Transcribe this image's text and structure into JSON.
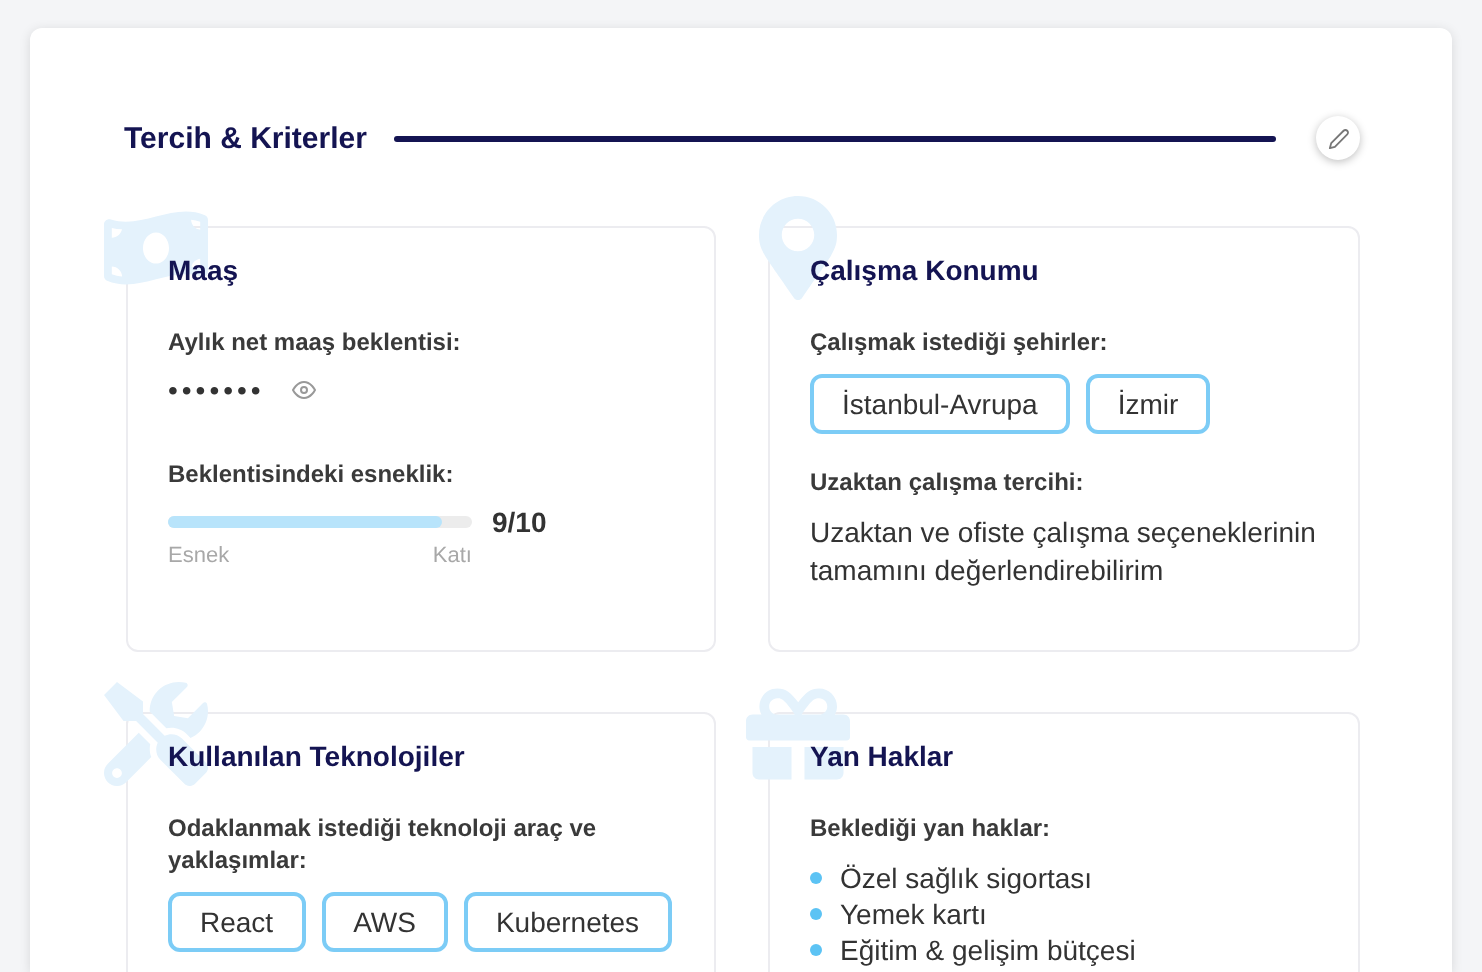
{
  "section": {
    "title": "Tercih & Kriterler"
  },
  "cards": [
    {
      "kind": "salary",
      "title": "Maaş",
      "blocks": [
        {
          "kind": "secret",
          "label": "Aylık net maaş beklentisi:",
          "value": "•••••••"
        },
        {
          "kind": "meter",
          "label": "Beklentisindeki esneklik:",
          "level": 0.9,
          "reading": "9/10",
          "min_label": "Esnek",
          "max_label": "Katı"
        }
      ]
    },
    {
      "kind": "location",
      "title": "Çalışma Konumu",
      "blocks": [
        {
          "kind": "tags",
          "label": "Çalışmak istediği şehirler:",
          "tags": [
            "İstanbul-Avrupa",
            "İzmir"
          ]
        },
        {
          "kind": "text",
          "label": "Uzaktan çalışma tercihi:",
          "text": "Uzaktan ve ofiste çalışma seçeneklerinin tamamını değerlendirebilirim"
        }
      ]
    },
    {
      "kind": "tech",
      "title": "Kullanılan Teknolojiler",
      "blocks": [
        {
          "kind": "tags",
          "label": "Odaklanmak istediği teknoloji araç ve yaklaşımlar:",
          "tags": [
            "React",
            "AWS",
            "Kubernetes"
          ]
        }
      ]
    },
    {
      "kind": "benefits",
      "title": "Yan Haklar",
      "blocks": [
        {
          "kind": "bullets",
          "label": "Beklediği yan haklar:",
          "items": [
            "Özel sağlık sigortası",
            "Yemek kartı",
            "Eğitim & gelişim bütçesi"
          ]
        }
      ]
    }
  ]
}
